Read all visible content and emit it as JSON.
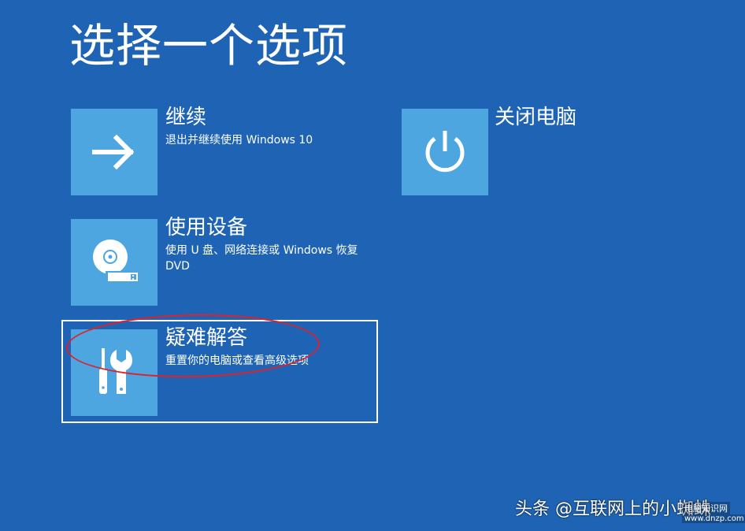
{
  "page": {
    "title": "选择一个选项",
    "background_color": "#1f64b4",
    "tile_color": "#4ea6e0"
  },
  "options": {
    "continue": {
      "title": "继续",
      "description": "退出并继续使用 Windows 10",
      "icon": "arrow-right-icon"
    },
    "use_device": {
      "title": "使用设备",
      "description": "使用 U 盘、网络连接或 Windows 恢复 DVD",
      "icon": "disc-usb-icon"
    },
    "troubleshoot": {
      "title": "疑难解答",
      "description": "重置你的电脑或查看高级选项",
      "icon": "tools-icon",
      "selected": true
    },
    "shutdown": {
      "title": "关闭电脑",
      "icon": "power-icon"
    }
  },
  "annotation": {
    "color": "#e0202a",
    "shape": "ellipse"
  },
  "watermark": {
    "text": "头条 @互联网上的小蜘蛛",
    "site": "电脑知识网",
    "url": "www.dnzp.com"
  }
}
